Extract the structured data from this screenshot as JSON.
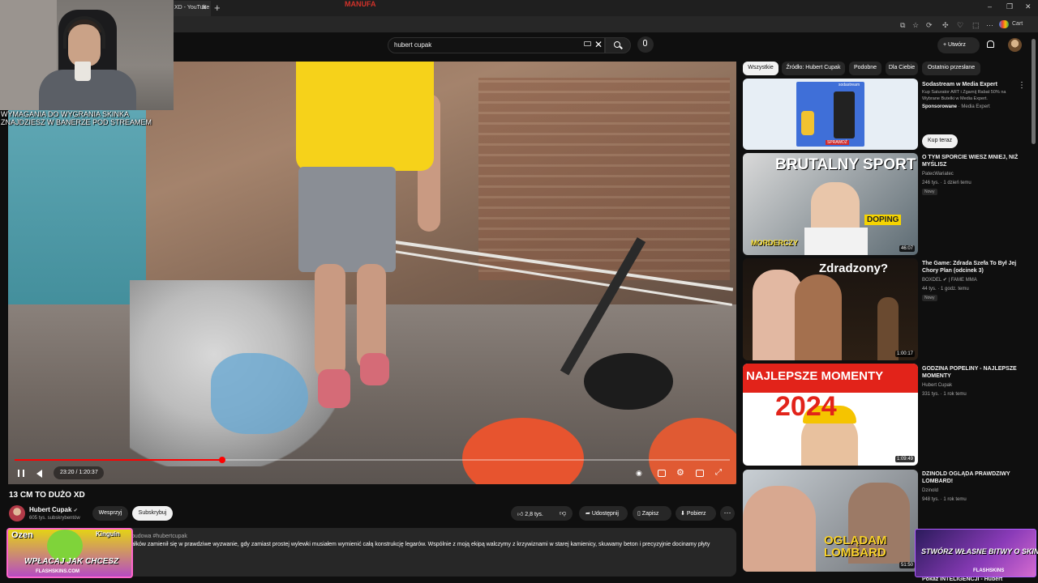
{
  "browser": {
    "tab_title": "XD - YouTube",
    "profile_label": "Cart",
    "new_tab_symbol": "+",
    "close_symbol": "✕",
    "window_controls": [
      "–",
      "❐",
      "✕"
    ]
  },
  "header": {
    "search_query": "hubert cupak",
    "create_label": "Utwórz",
    "icons": [
      "keyboard-icon",
      "clear-icon",
      "search-icon",
      "mic-icon",
      "bell-icon",
      "avatar"
    ]
  },
  "stream_overlay": {
    "requirement_text": "WYMAGANIA DO WYGRANIA SKINKA ZNAJDZIESZ W BANERZE POD STREAMEM"
  },
  "player": {
    "shirt_text": "MANUFA",
    "time_display": "23:20 / 1:20:37",
    "progress": 0.29,
    "controls": [
      "pause-icon",
      "volume-icon",
      "autoplay-icon",
      "subtitles-icon",
      "settings-icon",
      "miniplayer-icon",
      "theater-icon",
      "fullscreen-icon"
    ]
  },
  "video": {
    "title": "13 CM TO DUŻO XD",
    "channel_name": "Hubert Cupak",
    "verified_symbol": "✔",
    "subscribers": "605 tys. subskrybentów",
    "support_label": "Wesprzyj",
    "subscribe_label": "Subskrybuj",
    "likes": "2,8 tys.",
    "share_label": "Udostępnij",
    "save_label": "Zapisz",
    "download_label": "Pobierz",
    "more_label": "⋯",
    "description_line1": "budowa #hubertcupak",
    "description_line2": "ałków zamienił się w prawdziwe wyzwanie, gdy zamiast prostej wylewki musiałem wymienić całą konstrukcję legarów. Wspólnie z moją ekipą walczymy z krzywiznami w starej kamienicy, skuwamy beton i precyzyjnie docinamy płyty"
  },
  "zen_banner": {
    "logo": "Ozen",
    "partner": "Kinguin",
    "slogan": "WPŁACAJ JAK CHCESZ",
    "url": "FLASHSKINS.COM"
  },
  "filters": [
    "Wszystkie",
    "Źródło: Hubert Cupak",
    "Podobne",
    "Dla Ciebie",
    "Ostatnio przesłane"
  ],
  "sidebar": {
    "ad": {
      "title": "Sodastream w Media Expert",
      "description": "Kup Saturator ART i Zgarnij Rabat 50% na Wybrane Butelki w Media Expert.",
      "sponsor_label": "Sponsorowane",
      "sponsor_name": "Media Expert",
      "cta": "Kup teraz",
      "thumb_text": "sodastream",
      "thumb_button": "SPRAWDŹ"
    },
    "videos": [
      {
        "title": "O TYM SPORCIE WIESZ MNIEJ, NIŻ MYŚLISZ",
        "channel": "PatecWariatec",
        "meta": "246 tys. · 1 dzień temu",
        "badge": "Nowy",
        "duration": "46:07",
        "thumb_text": "BRUTALNY SPORT",
        "thumb_sub": "MORDERCZY",
        "thumb_sub2": "DOPING"
      },
      {
        "title": "The Game: Zdrada Szefa To Był Jej Chory Plan (odcinek 3)",
        "channel": "BOXDEL ✔ | FAME MMA",
        "meta": "44 tys. · 1 godz. temu",
        "badge": "Nowy",
        "duration": "1:00:17",
        "thumb_text": "Zdradzony?"
      },
      {
        "title": "GODZINA POPELINY - NAJLEPSZE MOMENTY",
        "channel": "Hubert Cupak",
        "meta": "331 tys. · 1 rok temu",
        "badge": "",
        "duration": "1:09:49",
        "thumb_text": "NAJLEPSZE MOMENTY",
        "thumb_sub": "2024"
      },
      {
        "title": "DZINOLD OGLĄDA PRAWDZIWY LOMBARD!",
        "channel": "Dzinold",
        "meta": "948 tys. · 1 rok temu",
        "badge": "",
        "duration": "51:50",
        "thumb_text": "OGLĄDAM LOMBARD"
      }
    ],
    "partial_title": "Pokaz INTELIGENCJI - Hubert"
  },
  "flashskins_banner": {
    "slogan": "STWÓRZ WŁASNE BITWY O SKINY!",
    "logo": "FLASHSKINS"
  }
}
